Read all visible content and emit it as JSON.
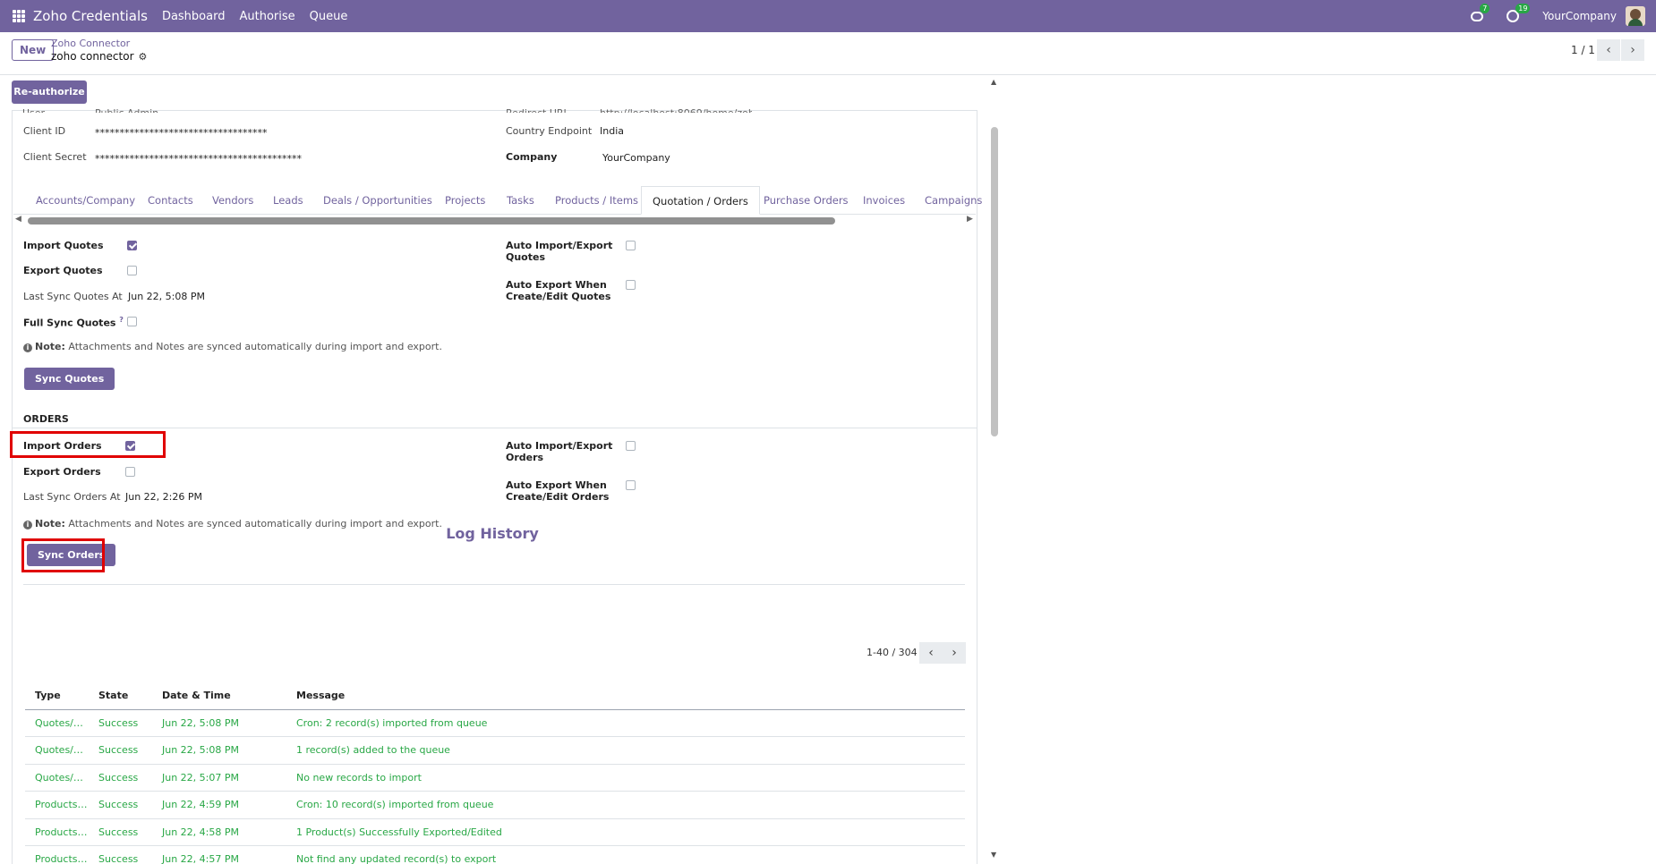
{
  "navbar": {
    "brand": "Zoho Credentials",
    "menu": [
      "Dashboard",
      "Authorise",
      "Queue"
    ],
    "messages_count": "7",
    "activities_count": "19",
    "company": "YourCompany",
    "color": "#71639e"
  },
  "control": {
    "new_label": "New",
    "breadcrumb_parent": "Zoho Connector",
    "breadcrumb_current": "zoho connector",
    "pager": "1 / 1"
  },
  "form": {
    "reauthorize_label": "Re-authorize",
    "client_id_label": "Client ID",
    "client_id_value": "***********************************",
    "client_secret_label": "Client Secret",
    "client_secret_value": "******************************************",
    "country_endpoint_label": "Country Endpoint",
    "country_endpoint_value": "India",
    "company_label": "Company",
    "company_value": "YourCompany"
  },
  "tabs": [
    "Accounts/Company",
    "Contacts",
    "Vendors",
    "Leads",
    "Deals / Opportunities",
    "Projects",
    "Tasks",
    "Products / Items",
    "Quotation / Orders",
    "Purchase Orders",
    "Invoices",
    "Campaigns"
  ],
  "active_tab": "Quotation / Orders",
  "quotes": {
    "import_label": "Import Quotes",
    "import_checked": true,
    "export_label": "Export Quotes",
    "export_checked": false,
    "last_sync_label": "Last Sync Quotes At",
    "last_sync_value": "Jun 22, 5:08 PM",
    "full_sync_label": "Full Sync Quotes",
    "full_sync_help": "?",
    "full_sync_checked": false,
    "auto_import_label_1": "Auto Import/Export",
    "auto_import_label_2": "Quotes",
    "auto_export_label_1": "Auto Export When",
    "auto_export_label_2": "Create/Edit Quotes",
    "note_bold": "Note:",
    "note_text": " Attachments and Notes are synced automatically during import and export.",
    "sync_button": "Sync Quotes"
  },
  "orders": {
    "section_title": "ORDERS",
    "import_label": "Import Orders",
    "import_checked": true,
    "export_label": "Export Orders",
    "export_checked": false,
    "last_sync_label": "Last Sync Orders At",
    "last_sync_value": "Jun 22, 2:26 PM",
    "auto_import_label_1": "Auto Import/Export",
    "auto_import_label_2": "Orders",
    "auto_export_label_1": "Auto Export When",
    "auto_export_label_2": "Create/Edit Orders",
    "note_bold": "Note:",
    "note_text": " Attachments and Notes are synced automatically during import and export.",
    "sync_button": "Sync Orders"
  },
  "log": {
    "title": "Log History",
    "pager": "1-40 / 304",
    "columns": [
      "Type",
      "State",
      "Date & Time",
      "Message"
    ],
    "rows": [
      [
        "Quotes/E...",
        "Success",
        "Jun 22, 5:08 PM",
        "Cron: 2 record(s) imported from queue"
      ],
      [
        "Quotes/E...",
        "Success",
        "Jun 22, 5:08 PM",
        "1 record(s) added to the queue"
      ],
      [
        "Quotes/E...",
        "Success",
        "Jun 22, 5:07 PM",
        "No new records to import"
      ],
      [
        "Products/...",
        "Success",
        "Jun 22, 4:59 PM",
        "Cron: 10 record(s) imported from queue"
      ],
      [
        "Products/...",
        "Success",
        "Jun 22, 4:58 PM",
        "1 Product(s) Successfully Exported/Edited"
      ],
      [
        "Products/...",
        "Success",
        "Jun 22, 4:57 PM",
        "Not find any updated record(s) to export"
      ]
    ],
    "success_color": "#28a745"
  },
  "highlight_color": "#e00000"
}
